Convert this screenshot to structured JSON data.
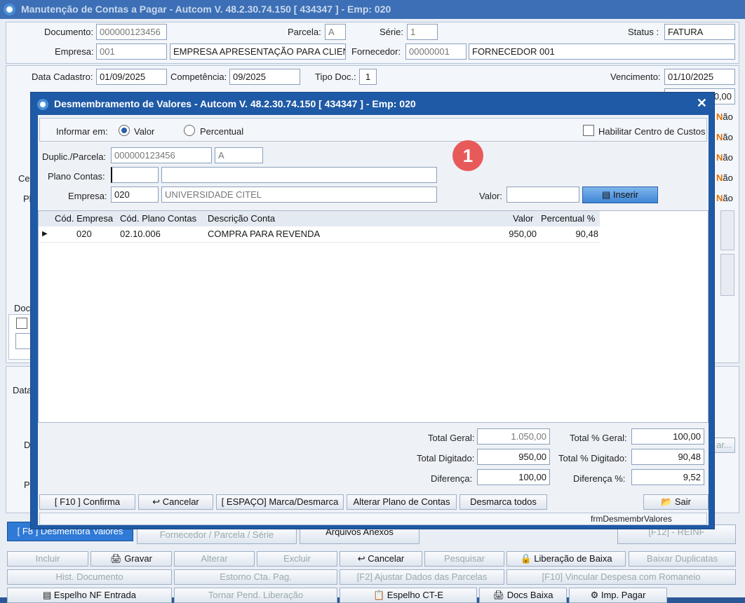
{
  "main": {
    "title": "Manutenção de Contas a Pagar  -  Autcom V. 48.2.30.74.150 [ 434347 ] - Emp: 020",
    "documento_label": "Documento:",
    "documento": "000000123456",
    "parcela_label": "Parcela:",
    "parcela": "A",
    "serie_label": "Série:",
    "serie": "1",
    "status_label": "Status :",
    "status": "FATURA",
    "empresa_label": "Empresa:",
    "empresa_code": "001",
    "empresa_name": "EMPRESA APRESENTAÇÃO PARA CLIENT",
    "fornecedor_label": "Fornecedor:",
    "fornecedor_code": "00000001",
    "fornecedor_name": "FORNECEDOR 001",
    "data_cadastro_label": "Data Cadastro:",
    "data_cadastro": "01/09/2025",
    "competencia_label": "Competência:",
    "competencia": "09/2025",
    "tipo_doc_label": "Tipo Doc.:",
    "tipo_doc": "1",
    "vencimento_label": "Vencimento:",
    "vencimento": "01/10/2025",
    "partial_value": "0,00",
    "nao_text": "N",
    "nao_suffix": "ão",
    "doc_label": "Doc",
    "ce_label": "Ce",
    "pl_label": "Pl",
    "data_label": "Data",
    "d_label": "D",
    "p_label": "P",
    "ar_label": "ar..."
  },
  "tabs": {
    "desmembra": "[ F8 ] Desmembra Valores",
    "fornecedor": "Fornecedor / Parcela / Série",
    "arquivos": "Arquivos Anexos",
    "reinf": "[F12] - REINF"
  },
  "toolbar1": [
    "Incluir",
    "Gravar",
    "Alterar",
    "Excluir",
    "Cancelar",
    "Pesquisar",
    "Liberação de Baixa",
    "Baixar Duplicatas"
  ],
  "toolbar2": [
    "Hist. Documento",
    "Estorno Cta. Pag.",
    "[F2] Ajustar Dados das Parcelas",
    "[F10] Vincular Despesa com Romaneio"
  ],
  "toolbar3": [
    "Espelho NF Entrada",
    "Tornar Pend. Liberação",
    "Espelho CT-E",
    "Docs Baixa",
    "Imp. Pagar"
  ],
  "dialog": {
    "title": "Desmembramento de Valores  -  Autcom V. 48.2.30.74.150 [ 434347 ] - Emp: 020",
    "informar_label": "Informar em:",
    "opt_valor": "Valor",
    "opt_percentual": "Percentual",
    "centro_custos": "Habilitar Centro de Custos",
    "duplic_label": "Duplic./Parcela:",
    "duplic": "000000123456",
    "duplic_parcela": "A",
    "plano_label": "Plano Contas:",
    "plano_code": "",
    "plano_desc": "",
    "empresa_label": "Empresa:",
    "empresa_code": "020",
    "empresa_name": "UNIVERSIDADE CITEL",
    "valor_label": "Valor:",
    "valor": "",
    "inserir": "Inserir",
    "badge": "1",
    "columns": [
      "Cód. Empresa",
      "Cód. Plano Contas",
      "Descrição Conta",
      "Valor",
      "Percentual %"
    ],
    "rows": [
      {
        "empresa": "020",
        "plano": "02.10.006",
        "descricao": "COMPRA PARA REVENDA",
        "valor": "950,00",
        "percentual": "90,48"
      }
    ],
    "total_geral_label": "Total Geral:",
    "total_geral": "1.050,00",
    "total_pct_geral_label": "Total % Geral:",
    "total_pct_geral": "100,00",
    "total_digitado_label": "Total Digitado:",
    "total_digitado": "950,00",
    "total_pct_digitado_label": "Total % Digitado:",
    "total_pct_digitado": "90,48",
    "diferenca_label": "Diferença:",
    "diferenca": "100,00",
    "diferenca_pct_label": "Diferença %:",
    "diferenca_pct": "9,52",
    "btn_confirma": "[ F10 ] Confirma",
    "btn_cancelar": "Cancelar",
    "btn_marca": "[ ESPAÇO] Marca/Desmarca",
    "btn_alterar": "Alterar Plano de Contas",
    "btn_desmarca": "Desmarca todos",
    "btn_sair": "Sair",
    "form_name": "frmDesmembrValores"
  }
}
